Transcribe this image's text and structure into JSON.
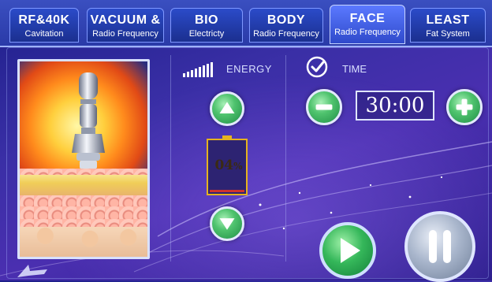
{
  "tabs": [
    {
      "title": "RF&40K",
      "subtitle": "Cavitation"
    },
    {
      "title": "VACUUM &",
      "subtitle": "Radio Frequency"
    },
    {
      "title": "BIO",
      "subtitle": "Electricty"
    },
    {
      "title": "BODY",
      "subtitle": "Radio Frequency"
    },
    {
      "title": "FACE",
      "subtitle": "Radio Frequency"
    },
    {
      "title": "LEAST",
      "subtitle": "Fat System"
    }
  ],
  "active_tab": "FACE",
  "energy": {
    "label": "ENERGY",
    "value": "04",
    "unit": "%",
    "level_fraction": 0.04
  },
  "time": {
    "label": "TIME",
    "value": "30:00"
  },
  "colors": {
    "accent_green": "#35b75a",
    "battery_border": "#e6b31e",
    "background": "#3a2fa6"
  },
  "icons": {
    "signal": "signal-bars-icon",
    "up": "arrow-up-icon",
    "down": "arrow-down-icon",
    "check": "check-circle-icon",
    "minus": "minus-icon",
    "plus": "plus-icon",
    "play": "play-icon",
    "pause": "pause-icon"
  }
}
